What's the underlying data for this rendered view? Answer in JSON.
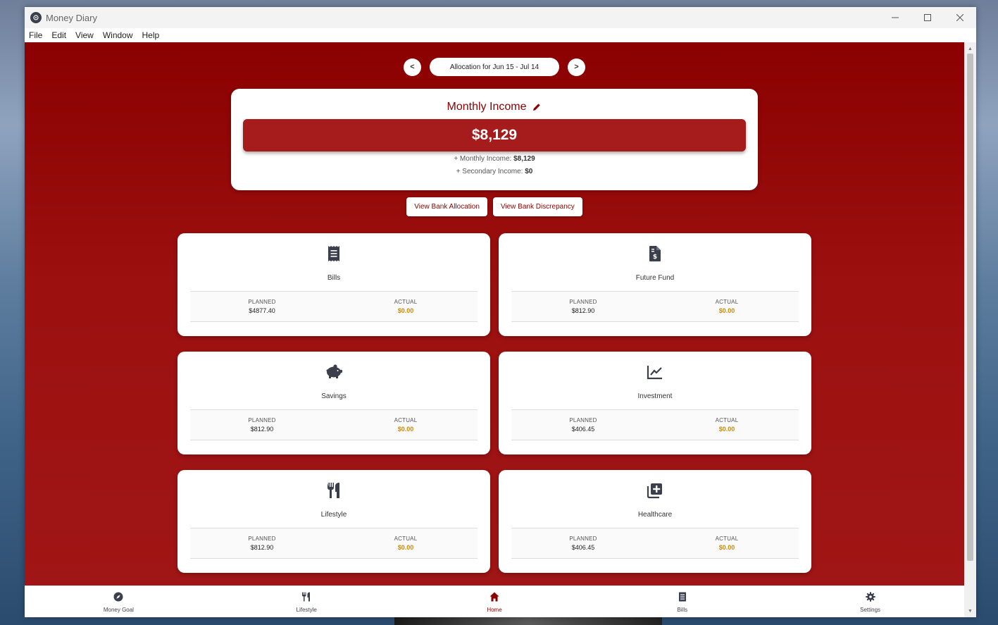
{
  "window": {
    "title": "Money Diary"
  },
  "menu": [
    "File",
    "Edit",
    "View",
    "Window",
    "Help"
  ],
  "period": {
    "prev_label": "<",
    "next_label": ">",
    "label": "Allocation for Jun 15 - Jul 14"
  },
  "income": {
    "title": "Monthly Income",
    "total": "$8,129",
    "monthly_prefix": "+ Monthly Income:",
    "monthly_value": "$8,129",
    "secondary_prefix": "+ Secondary Income:",
    "secondary_value": "$0"
  },
  "bank_buttons": {
    "allocation": "View Bank Allocation",
    "discrepancy": "View Bank Discrepancy"
  },
  "labels": {
    "planned": "PLANNED",
    "actual": "ACTUAL"
  },
  "categories": [
    {
      "name": "Bills",
      "icon": "receipt-icon",
      "planned": "$4877.40",
      "actual": "$0.00"
    },
    {
      "name": "Future Fund",
      "icon": "file-invoice-dollar-icon",
      "planned": "$812.90",
      "actual": "$0.00"
    },
    {
      "name": "Savings",
      "icon": "piggy-bank-icon",
      "planned": "$812.90",
      "actual": "$0.00"
    },
    {
      "name": "Investment",
      "icon": "chart-line-icon",
      "planned": "$406.45",
      "actual": "$0.00"
    },
    {
      "name": "Lifestyle",
      "icon": "utensils-icon",
      "planned": "$812.90",
      "actual": "$0.00"
    },
    {
      "name": "Healthcare",
      "icon": "medical-plus-icon",
      "planned": "$406.45",
      "actual": "$0.00"
    }
  ],
  "bottom_nav": [
    {
      "label": "Money Goal",
      "icon": "compass-icon"
    },
    {
      "label": "Lifestyle",
      "icon": "utensils-icon"
    },
    {
      "label": "Home",
      "icon": "home-icon",
      "active": true
    },
    {
      "label": "Bills",
      "icon": "receipt-icon"
    },
    {
      "label": "Settings",
      "icon": "gear-icon"
    }
  ],
  "colors": {
    "primary": "#8b0000",
    "income_box": "#a61b1b",
    "actual": "#d08b00"
  }
}
